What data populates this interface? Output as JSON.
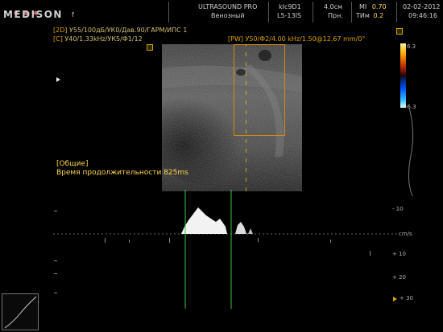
{
  "header": {
    "brand": "MEDISON",
    "brand_mark": "f",
    "model": "ULTRASOUND PRO",
    "preset": "Венозный",
    "probe_code": "kIc9D1",
    "probe_name": "L5-13IS",
    "depth": "4.0см",
    "mode": "Прн.",
    "mi_label": "MI",
    "mi_value": "0.70",
    "tim_label": "TИм",
    "tim_value": "0.2",
    "date": "02-02-2012",
    "time": "09:46:16"
  },
  "params": {
    "line1_tag": "[2D]",
    "line1": "У55/100дБ/УК0/Дав.90/ГАРМ/ИПС 1",
    "line2_tag": "[C]",
    "line2": "У40/1.33kHz/УК5/Ф1/12",
    "pw": "[PW] У50/Ф2/4.00 kHz/1.50@12.67 mm/0°"
  },
  "color_scale": {
    "top": "6.3",
    "bottom": "-6.3"
  },
  "measurement": {
    "group": "[Общие]",
    "label": "Время продолжительности",
    "value": "825ms"
  },
  "doppler_scale": {
    "unit": "cm/s",
    "ticks": [
      "- 10",
      "+ 10",
      "+ 20",
      "+ 30"
    ]
  }
}
